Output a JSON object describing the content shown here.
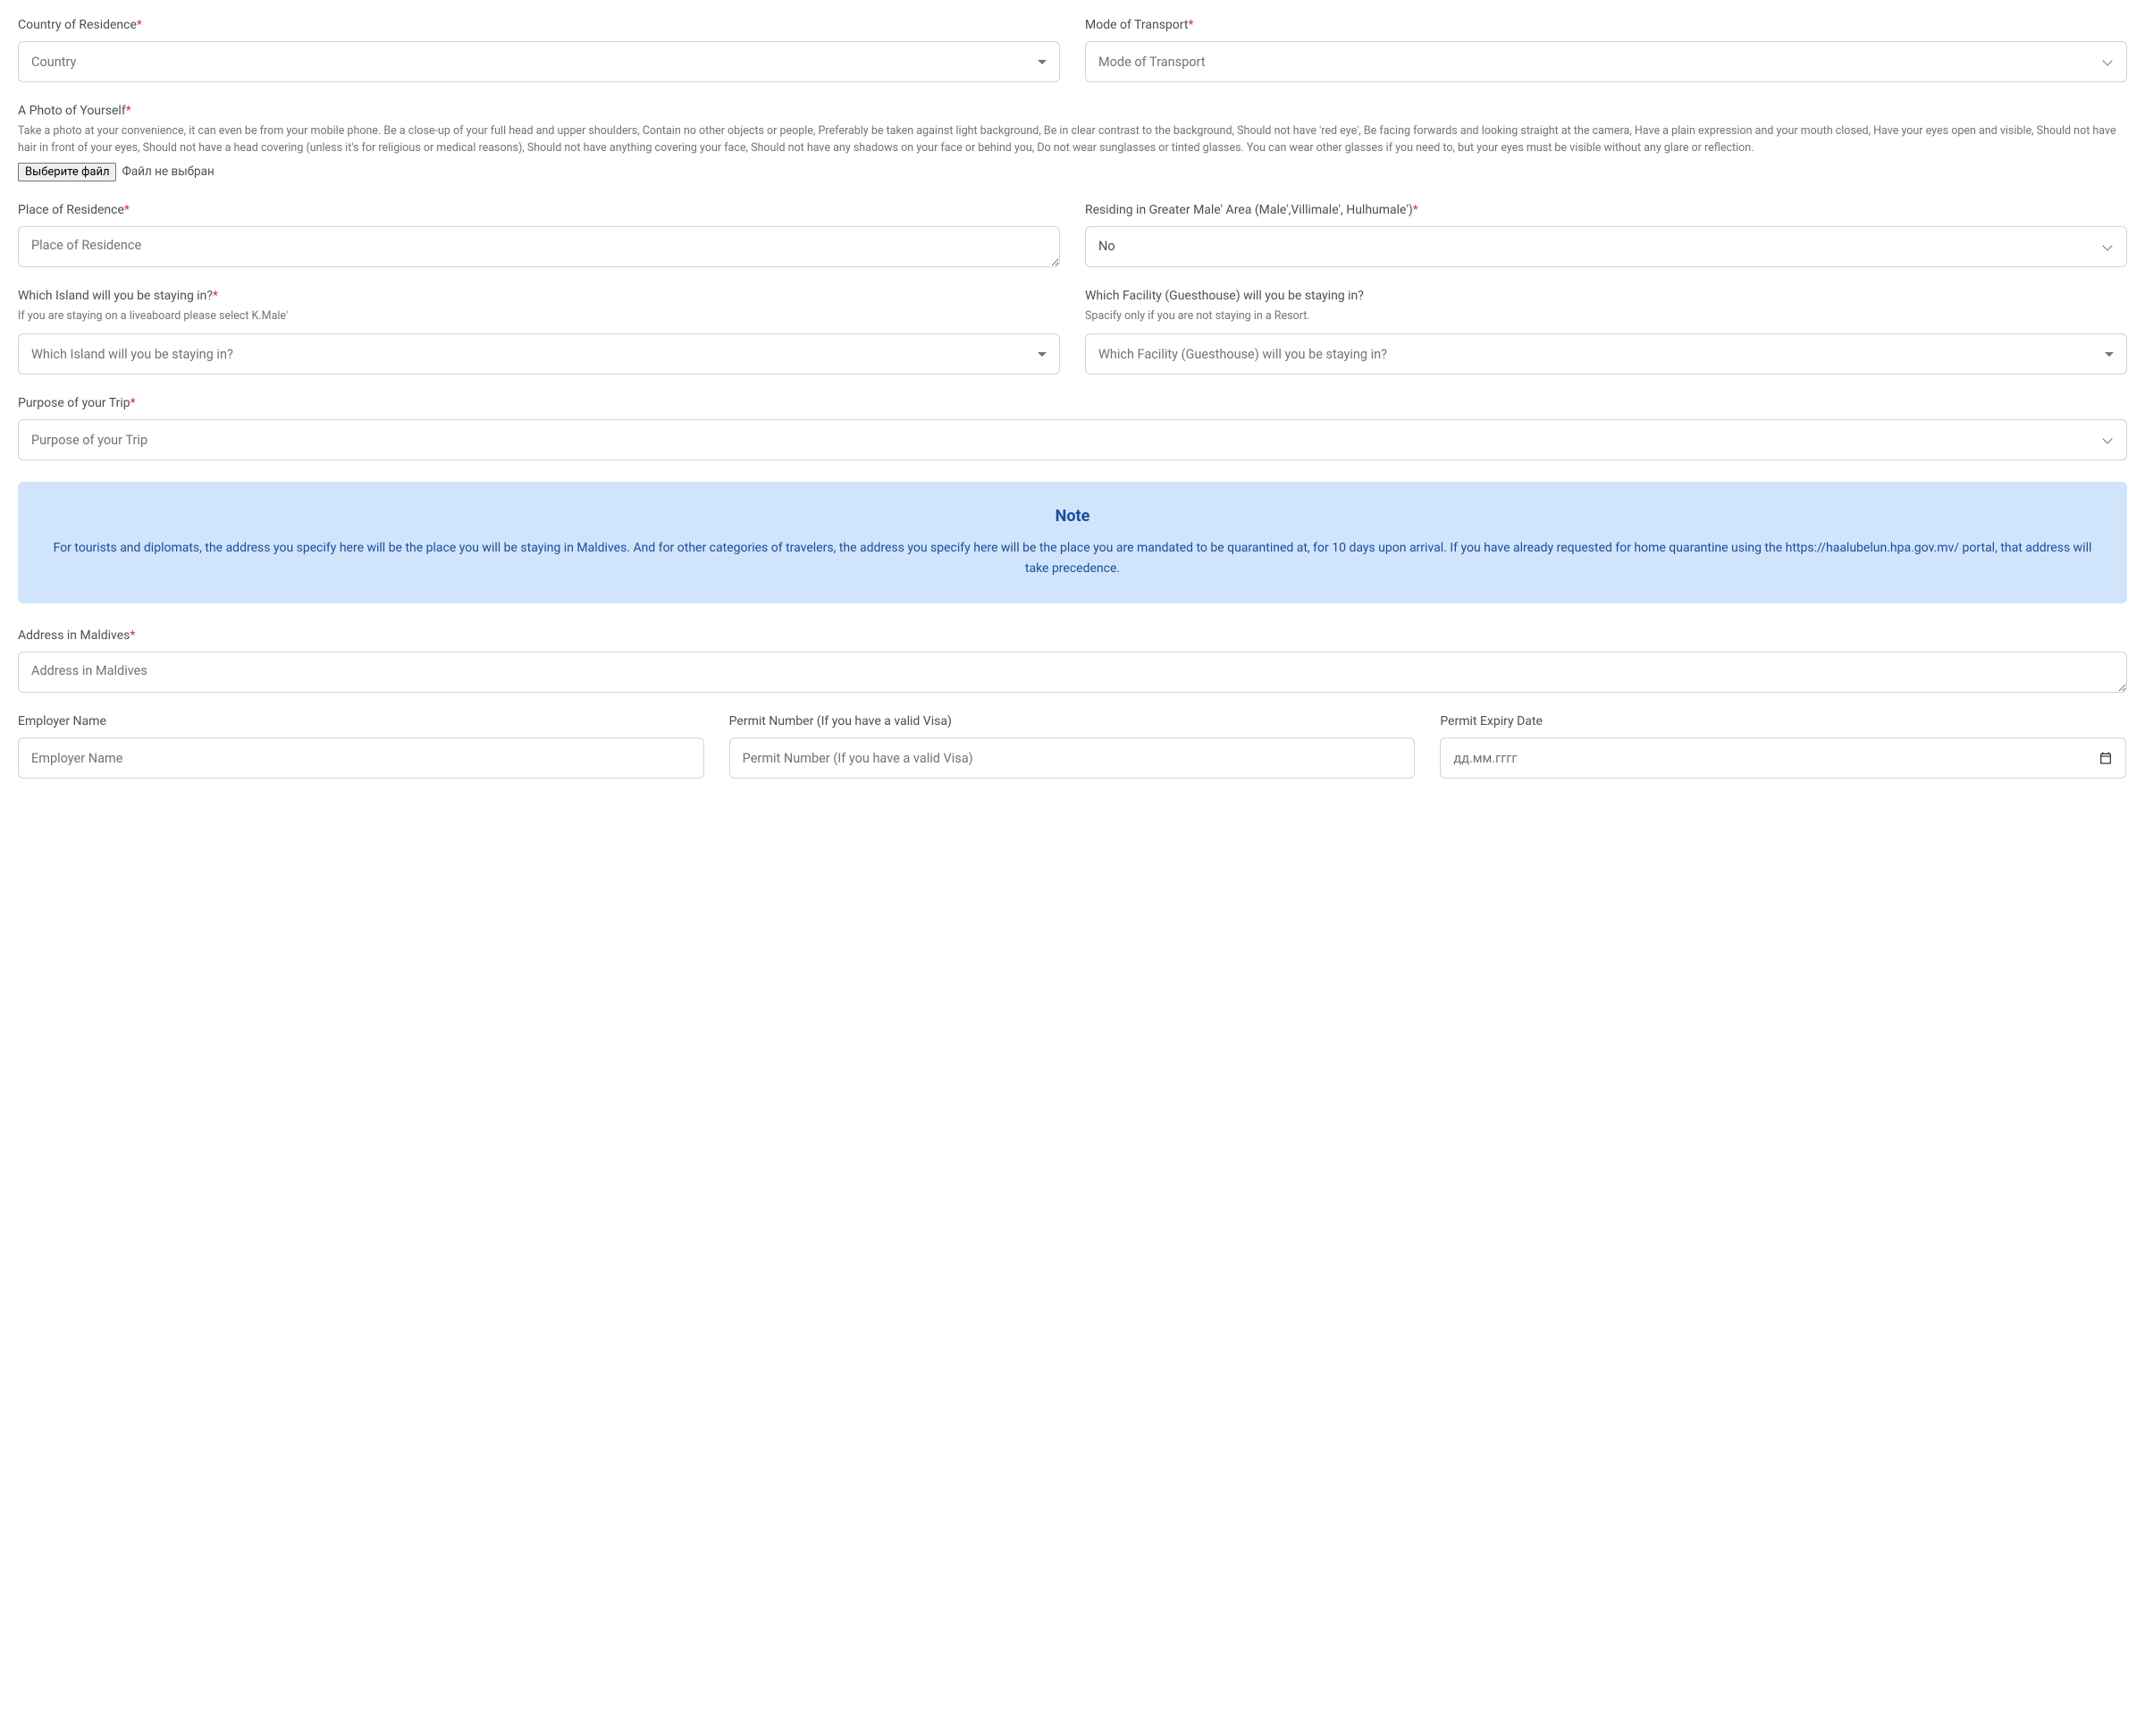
{
  "country": {
    "label": "Country of Residence",
    "placeholder": "Country"
  },
  "transport": {
    "label": "Mode of Transport",
    "placeholder": "Mode of Transport"
  },
  "photo": {
    "label": "A Photo of Yourself",
    "help": "Take a photo at your convenience, it can even be from your mobile phone. Be a close-up of your full head and upper shoulders, Contain no other objects or people, Preferably be taken against light background, Be in clear contrast to the background, Should not have 'red eye', Be facing forwards and looking straight at the camera, Have a plain expression and your mouth closed, Have your eyes open and visible, Should not have hair in front of your eyes, Should not have a head covering (unless it's for religious or medical reasons), Should not have anything covering your face, Should not have any shadows on your face or behind you, Do not wear sunglasses or tinted glasses. You can wear other glasses if you need to, but your eyes must be visible without any glare or reflection.",
    "button": "Выберите файл",
    "status": "Файл не выбран"
  },
  "residence_place": {
    "label": "Place of Residence",
    "placeholder": "Place of Residence"
  },
  "greater_male": {
    "label": "Residing in Greater Male' Area (Male',Villimale', Hulhumale')",
    "value": "No"
  },
  "island": {
    "label": "Which Island will you be staying in?",
    "help": "If you are staying on a liveaboard please select K.Male'",
    "placeholder": "Which Island will you be staying in?"
  },
  "facility": {
    "label": "Which Facility (Guesthouse) will you be staying in?",
    "help": "Spacify only if you are not staying in a Resort.",
    "placeholder": "Which Facility (Guesthouse) will you be staying in?"
  },
  "purpose": {
    "label": "Purpose of your Trip",
    "placeholder": "Purpose of your Trip"
  },
  "note": {
    "title": "Note",
    "body": "For tourists and diplomats, the address you specify here will be the place you will be staying in Maldives. And for other categories of travelers, the address you specify here will be the place you are mandated to be quarantined at, for 10 days upon arrival. If you have already requested for home quarantine using the https://haalubelun.hpa.gov.mv/ portal, that address will take precedence."
  },
  "address": {
    "label": "Address in Maldives",
    "placeholder": "Address in Maldives"
  },
  "employer": {
    "label": "Employer Name",
    "placeholder": "Employer Name"
  },
  "permit_no": {
    "label": "Permit Number (If you have a valid Visa)",
    "placeholder": "Permit Number (If you have a valid Visa)"
  },
  "permit_exp": {
    "label": "Permit Expiry Date",
    "placeholder": "дд.мм.гггг"
  }
}
